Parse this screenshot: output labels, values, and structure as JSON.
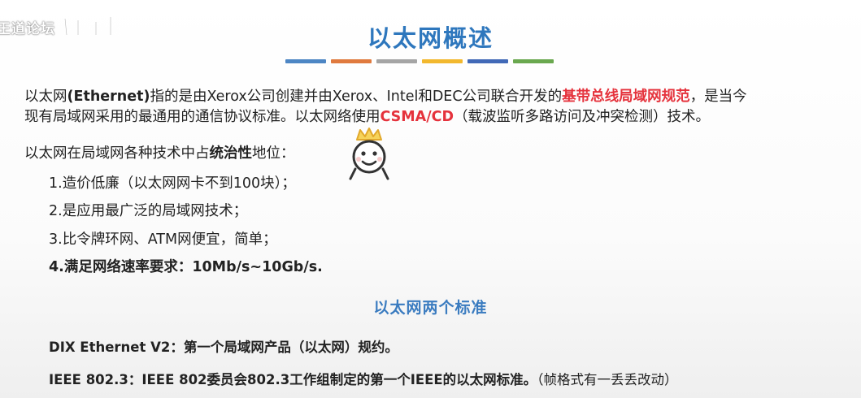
{
  "watermark": {
    "text": "王道论坛"
  },
  "title": "以太网概述",
  "divider_colors": [
    "#4d86c4",
    "#e07a3e",
    "#a5a5a5",
    "#f2b82e",
    "#4169b7",
    "#6aa84f"
  ],
  "intro": {
    "l1_a": "以太网",
    "l1_b": "(Ethernet)",
    "l1_c": "指的是由Xerox公司创建并由Xerox、Intel和DEC公司联合开发的",
    "l1_d": "基带总线局域网规范",
    "l1_e": "，是当今",
    "l2_a": "现有局域网采用的最通用的通信协议标准。以太网络使用",
    "l2_b": "CSMA/CD",
    "l2_c": "（载波监听多路访问及冲突检测）技术。"
  },
  "dominance": {
    "a": "以太网在局域网各种技术中占",
    "b": "统治性",
    "c": "地位："
  },
  "reasons": [
    "1.造价低廉（以太网网卡不到100块）；",
    "2.是应用最广泛的局域网技术；",
    "3.比令牌环网、ATM网便宜，简单；",
    "4.满足网络速率要求：10Mb/s~10Gb/s."
  ],
  "standards_title": "以太网两个标准",
  "standards": {
    "dix_label": "DIX Ethernet V2：",
    "dix_text": "第一个局域网产品（以太网）规约。",
    "ieee_label": "IEEE 802.3：",
    "ieee_text": "IEEE 802委员会802.3工作组制定的第一个IEEE的以太网标准。",
    "ieee_note": "（帧格式有一丢丢改动）"
  }
}
